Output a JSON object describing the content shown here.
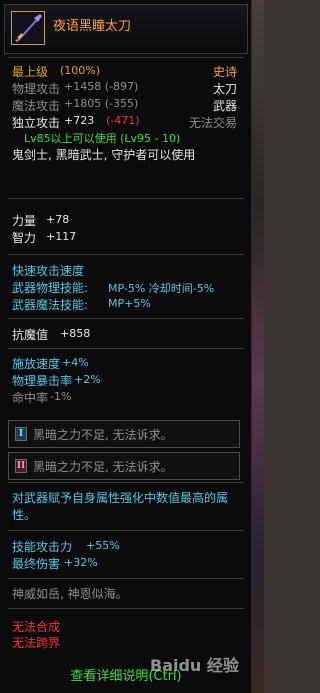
{
  "item": {
    "name": "夜语黑瞳太刀",
    "grade_label": "最上级",
    "grade_pct": "(100%)",
    "rarity": "史诗",
    "type": "太刀",
    "category": "武器",
    "trade": "无法交易"
  },
  "stats": {
    "phys_atk_label": "物理攻击",
    "phys_atk_val": "+1458 (-897)",
    "mag_atk_label": "魔法攻击",
    "mag_atk_val": "+1805 (-355)",
    "indep_atk_label": "独立攻击",
    "indep_atk_val": "+723",
    "indep_atk_diff": "(-471)"
  },
  "requirements": {
    "level": "Lv85以上可以使用 (Lv95 - 10)",
    "classes": "鬼剑士, 黑暗武士, 守护者可以使用"
  },
  "attributes": [
    {
      "label": "力量",
      "value": "+78"
    },
    {
      "label": "智力",
      "value": "+117"
    }
  ],
  "skills": {
    "line1": "快速攻击速度",
    "line2_label": "武器物理技能:",
    "line2_value": "MP-5% 冷却时间-5%",
    "line3_label": "武器魔法技能:",
    "line3_value": "MP+5%"
  },
  "resist": {
    "label": "抗魔值",
    "value": "+858"
  },
  "speed": [
    {
      "label": "施放速度",
      "value": "+4%"
    },
    {
      "label": "物理暴击率",
      "value": "+2%"
    }
  ],
  "hit": {
    "label": "命中率",
    "value": "-1%"
  },
  "sockets": [
    {
      "badge": "I",
      "text": "黑暗之力不足, 无法诉求。"
    },
    {
      "badge": "II",
      "text": "黑暗之力不足, 无法诉求。"
    }
  ],
  "desc": "对武器赋予自身属性强化中数值最高的属性。",
  "bonus": [
    {
      "label": "技能攻击力",
      "value": "+55%"
    },
    {
      "label": "最终伤害",
      "value": "+32%"
    }
  ],
  "flavor": "神威如岳, 神恩似海。",
  "restrictions": [
    "无法合成",
    "无法跨界"
  ],
  "footer": "查看详细说明(Ctrl)",
  "watermark": "Baidu 经验",
  "colors": {
    "epic": "#ffa03c",
    "green": "#3ae03a",
    "red": "#ff3030",
    "cyan": "#57c8e6"
  }
}
